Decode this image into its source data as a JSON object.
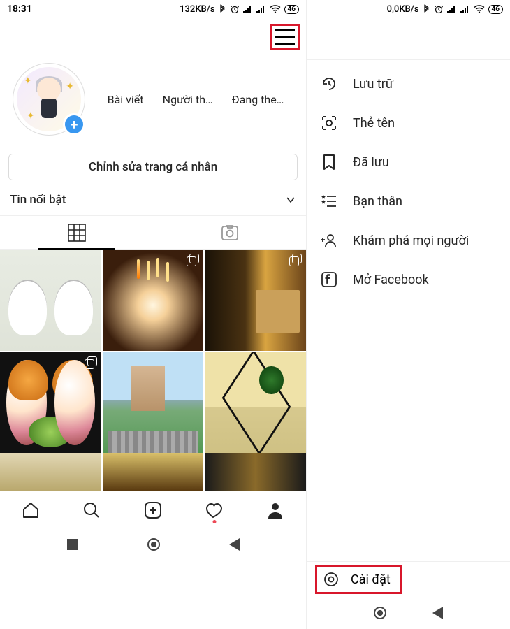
{
  "left": {
    "status": {
      "time": "18:31",
      "speed": "132KB/s",
      "battery": "46"
    },
    "stats": {
      "posts_label": "Bài viết",
      "followers_label": "Người th…",
      "following_label": "Đang the…"
    },
    "edit_profile": "Chỉnh sửa trang cá nhân",
    "highlights": "Tin nổi bật"
  },
  "right": {
    "status": {
      "speed": "0,0KB/s",
      "battery": "46"
    },
    "menu": {
      "archive": "Lưu trữ",
      "nametag": "Thẻ tên",
      "saved": "Đã lưu",
      "close_friends": "Bạn thân",
      "discover": "Khám phá mọi người",
      "facebook": "Mở Facebook"
    },
    "settings": "Cài đặt"
  }
}
